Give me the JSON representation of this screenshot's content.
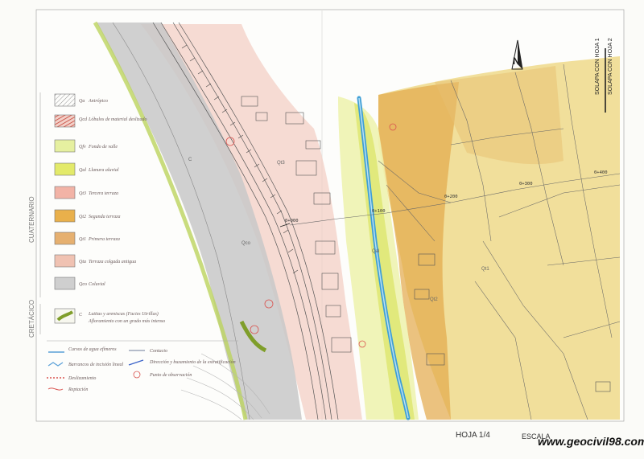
{
  "legend": {
    "section_quaternary": "CUATERNARIO",
    "section_cretaceous": "CRETÁCICO",
    "units": [
      {
        "code": "Qa",
        "label": "Antrópico",
        "color": "#e8e8e8",
        "hatch": true
      },
      {
        "code": "Qcd",
        "label": "Lóbulos de material deslizado",
        "color": "#d9534f",
        "hatch": true
      },
      {
        "code": "Qfv",
        "label": "Fondo de valle",
        "color": "#e6f0a0"
      },
      {
        "code": "Qal",
        "label": "Llanura aluvial",
        "color": "#e3ea6a"
      },
      {
        "code": "Qt3",
        "label": "Tercera terraza",
        "color": "#f2b3a6"
      },
      {
        "code": "Qt2",
        "label": "Segunda terraza",
        "color": "#e9b04b"
      },
      {
        "code": "Qt1",
        "label": "Primera terraza",
        "color": "#e6b070"
      },
      {
        "code": "Qta",
        "label": "Terraza colgada antigua",
        "color": "#f0c2b2"
      },
      {
        "code": "Qco",
        "label": "Coluvial",
        "color": "#cfcfcf"
      },
      {
        "code": "C",
        "label": "Lutitas y areniscas (Facies Utrillas)",
        "sub": "Afloramiento con un grado más intenso",
        "color": "#b9cc5a"
      }
    ],
    "symbols": [
      {
        "label": "Cursos de agua efímeros",
        "color": "#5aa0d8"
      },
      {
        "label": "Contacto",
        "color": "#6d7b9a"
      },
      {
        "label": "Barrancos de incisión lineal",
        "color": "#5aa0d8"
      },
      {
        "label": "Dirección y buzamiento de la estratificación",
        "color": "#3a63c8"
      },
      {
        "label": "Deslizamiento",
        "color": "#d9534f"
      },
      {
        "label": "Punto de observación",
        "color": "#d9534f"
      },
      {
        "label": "Reptación",
        "color": "#d9534f"
      }
    ]
  },
  "map_labels": {
    "qt3": "Qt3",
    "qco": "Qco",
    "qal": "Qal",
    "qt2": "Qt2",
    "qt1": "Qt1",
    "c": "C",
    "chain_0": "0+000",
    "chain_100": "0+100",
    "chain_200": "0+200",
    "chain_300": "0+300",
    "chain_400": "0+400",
    "overlap_1": "SOLAPA CON HOJA 1",
    "overlap_2": "SOLAPA CON HOJA 2",
    "north": "N"
  },
  "footer": {
    "sheet": "HOJA 1/4",
    "scale": "ESCALA",
    "watermark": "www.geocivil98.com"
  }
}
